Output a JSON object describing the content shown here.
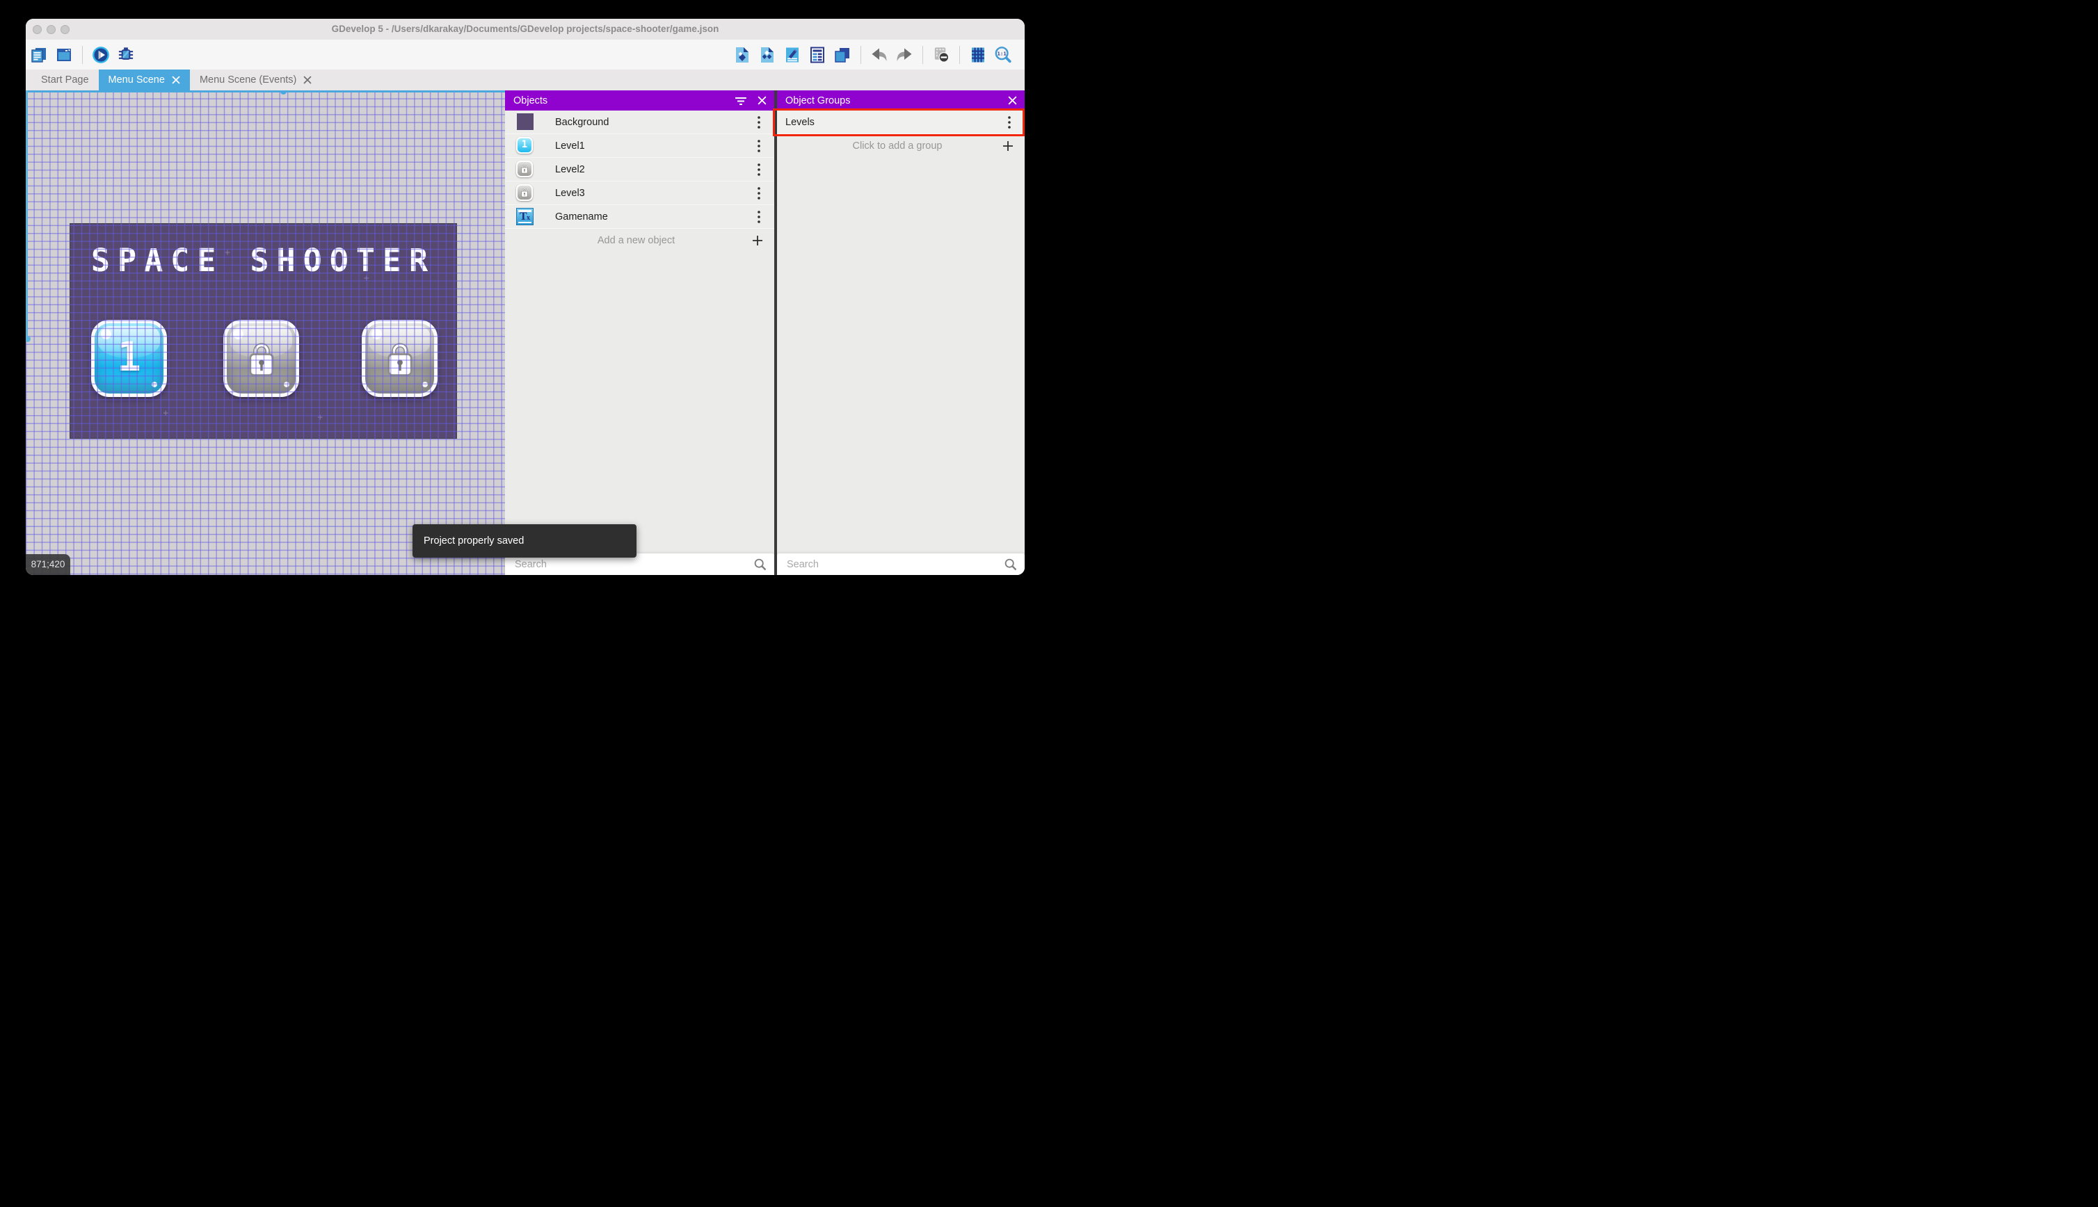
{
  "window": {
    "title": "GDevelop 5 - /Users/dkarakay/Documents/GDevelop projects/space-shooter/game.json",
    "traffic_lights": [
      "close",
      "minimize",
      "zoom"
    ]
  },
  "toolbar": {
    "left_icons": [
      "project-manager-icon",
      "window-icon",
      "preview-play-icon",
      "debug-icon"
    ],
    "right_icons": [
      "objects-panel-icon",
      "object-groups-panel-icon",
      "properties-panel-icon",
      "instances-list-icon",
      "layers-panel-icon",
      "undo-icon",
      "redo-icon",
      "window-mask-icon",
      "grid-icon",
      "zoom-1-1-icon"
    ]
  },
  "tabs": [
    {
      "label": "Start Page",
      "active": false,
      "closable": false
    },
    {
      "label": "Menu Scene",
      "active": true,
      "closable": true
    },
    {
      "label": "Menu Scene (Events)",
      "active": false,
      "closable": true
    }
  ],
  "scene": {
    "title": "SPACE SHOOTER",
    "buttons": [
      {
        "label": "1",
        "state": "unlocked"
      },
      {
        "label": "lock",
        "state": "locked"
      },
      {
        "label": "lock",
        "state": "locked"
      }
    ],
    "coordinates": "871;420"
  },
  "objects_panel": {
    "title": "Objects",
    "items": [
      {
        "name": "Background",
        "icon": "background-thumbnail"
      },
      {
        "name": "Level1",
        "icon": "blue-level-button"
      },
      {
        "name": "Level2",
        "icon": "locked-button"
      },
      {
        "name": "Level3",
        "icon": "locked-button"
      },
      {
        "name": "Gamename",
        "icon": "text-object"
      }
    ],
    "add_label": "Add a new object",
    "search_placeholder": "Search"
  },
  "groups_panel": {
    "title": "Object Groups",
    "groups": [
      {
        "name": "Levels",
        "highlighted": true
      }
    ],
    "add_label": "Click to add a group",
    "search_placeholder": "Search"
  },
  "toast": {
    "message": "Project properly saved"
  },
  "colors": {
    "accent_purple": "#9002cd",
    "tab_blue": "#4aa8de",
    "highlight_red": "#f3260b",
    "scene_purple": "#56486e",
    "grid_line": "#645ce4",
    "toast_bg": "#2f2f2f"
  }
}
